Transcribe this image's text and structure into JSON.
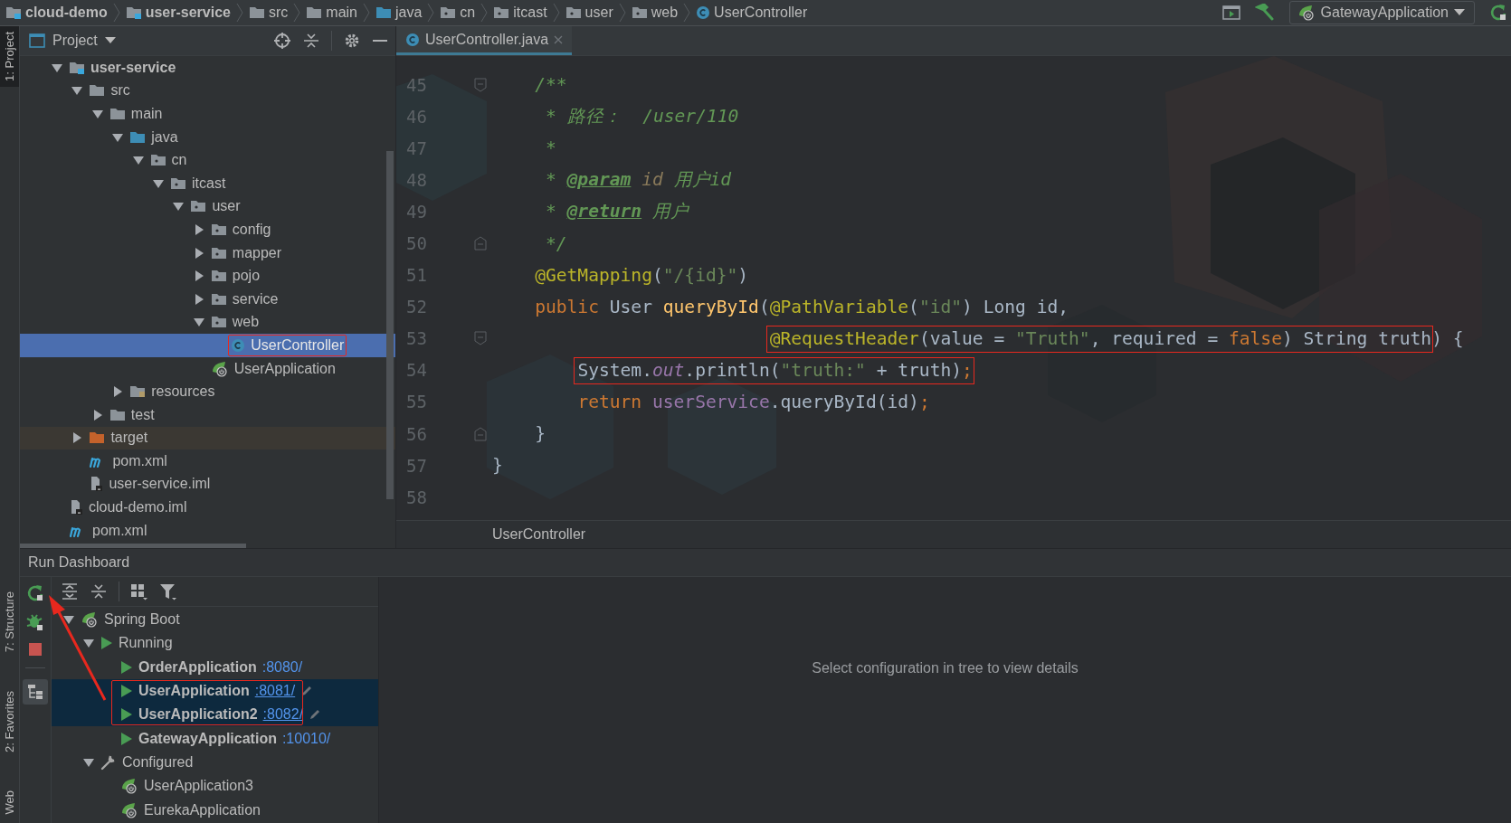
{
  "breadcrumbs": [
    {
      "label": "cloud-demo",
      "kind": "module"
    },
    {
      "label": "user-service",
      "kind": "module"
    },
    {
      "label": "src",
      "kind": "folder"
    },
    {
      "label": "main",
      "kind": "folder"
    },
    {
      "label": "java",
      "kind": "source"
    },
    {
      "label": "cn",
      "kind": "package"
    },
    {
      "label": "itcast",
      "kind": "package"
    },
    {
      "label": "user",
      "kind": "package"
    },
    {
      "label": "web",
      "kind": "package"
    },
    {
      "label": "UserController",
      "kind": "class"
    }
  ],
  "run_config": {
    "label": "GatewayApplication"
  },
  "tool_strip": {
    "top": [
      {
        "label": "1: Project",
        "selected": true
      }
    ],
    "bottom": [
      {
        "label": "7: Structure",
        "selected": false
      },
      {
        "label": "2: Favorites",
        "selected": false
      },
      {
        "label": "Web",
        "selected": false
      }
    ]
  },
  "project_panel": {
    "title": "Project",
    "tree": [
      {
        "label": "user-service",
        "kind": "module",
        "expanded": true,
        "selected": false,
        "boxed": false,
        "children": [
          {
            "label": "src",
            "kind": "folder",
            "expanded": true,
            "selected": false,
            "boxed": false,
            "children": [
              {
                "label": "main",
                "kind": "folder",
                "expanded": true,
                "selected": false,
                "boxed": false,
                "children": [
                  {
                    "label": "java",
                    "kind": "source",
                    "expanded": true,
                    "selected": false,
                    "boxed": false,
                    "children": [
                      {
                        "label": "cn",
                        "kind": "package",
                        "expanded": true,
                        "selected": false,
                        "boxed": false,
                        "children": [
                          {
                            "label": "itcast",
                            "kind": "package",
                            "expanded": true,
                            "selected": false,
                            "boxed": false,
                            "children": [
                              {
                                "label": "user",
                                "kind": "package",
                                "expanded": true,
                                "selected": false,
                                "boxed": false,
                                "children": [
                                  {
                                    "label": "config",
                                    "kind": "package",
                                    "expanded": false,
                                    "selected": false,
                                    "boxed": false
                                  },
                                  {
                                    "label": "mapper",
                                    "kind": "package",
                                    "expanded": false,
                                    "selected": false,
                                    "boxed": false
                                  },
                                  {
                                    "label": "pojo",
                                    "kind": "package",
                                    "expanded": false,
                                    "selected": false,
                                    "boxed": false
                                  },
                                  {
                                    "label": "service",
                                    "kind": "package",
                                    "expanded": false,
                                    "selected": false,
                                    "boxed": false
                                  },
                                  {
                                    "label": "web",
                                    "kind": "package",
                                    "expanded": true,
                                    "selected": false,
                                    "boxed": false,
                                    "children": [
                                      {
                                        "label": "UserController",
                                        "kind": "class",
                                        "selected": true,
                                        "boxed": true
                                      }
                                    ]
                                  },
                                  {
                                    "label": "UserApplication",
                                    "kind": "spring-app",
                                    "selected": false,
                                    "boxed": false
                                  }
                                ]
                              }
                            ]
                          }
                        ]
                      }
                    ]
                  },
                  {
                    "label": "resources",
                    "kind": "resources",
                    "expanded": false,
                    "selected": false,
                    "boxed": false
                  }
                ]
              },
              {
                "label": "test",
                "kind": "folder",
                "expanded": false,
                "selected": false,
                "boxed": false
              }
            ]
          },
          {
            "label": "target",
            "kind": "excluded",
            "expanded": false,
            "selected": false,
            "boxed": false
          },
          {
            "label": "pom.xml",
            "kind": "xml",
            "selected": false,
            "boxed": false
          },
          {
            "label": "user-service.iml",
            "kind": "iml",
            "selected": false,
            "boxed": false
          }
        ]
      },
      {
        "label": "cloud-demo.iml",
        "kind": "iml",
        "selected": false,
        "boxed": false
      },
      {
        "label": "pom.xml",
        "kind": "xml",
        "selected": false,
        "boxed": false
      }
    ]
  },
  "editor": {
    "tab": {
      "label": "UserController.java",
      "selected": true
    },
    "lines": [
      {
        "number": "45",
        "kind": "fold-start",
        "tokens": [
          {
            "text": "    /**",
            "kind": "comment"
          }
        ]
      },
      {
        "number": "46",
        "kind": "plain",
        "tokens": [
          {
            "text": "     * 路径：  /user/110",
            "kind": "comment"
          }
        ]
      },
      {
        "number": "47",
        "kind": "plain",
        "tokens": [
          {
            "text": "     *",
            "kind": "comment"
          }
        ]
      },
      {
        "number": "48",
        "kind": "plain",
        "tokens": [
          {
            "text": "     * ",
            "kind": "comment"
          },
          {
            "text": "@param",
            "kind": "doctag"
          },
          {
            "text": " id",
            "kind": "param"
          },
          {
            "text": " 用户id",
            "kind": "comment"
          }
        ]
      },
      {
        "number": "49",
        "kind": "plain",
        "tokens": [
          {
            "text": "     * ",
            "kind": "comment"
          },
          {
            "text": "@return",
            "kind": "doctag"
          },
          {
            "text": " 用户",
            "kind": "comment"
          }
        ]
      },
      {
        "number": "50",
        "kind": "fold-end",
        "tokens": [
          {
            "text": "     */",
            "kind": "comment"
          }
        ]
      },
      {
        "number": "51",
        "kind": "plain",
        "tokens": [
          {
            "text": "    @GetMapping",
            "kind": "annotation"
          },
          {
            "text": "(",
            "kind": "plain"
          },
          {
            "text": "\"/{id}\"",
            "kind": "string"
          },
          {
            "text": ")",
            "kind": "plain"
          }
        ]
      },
      {
        "number": "52",
        "kind": "plain",
        "tokens": [
          {
            "text": "    public",
            "kind": "keyword"
          },
          {
            "text": " User ",
            "kind": "plain"
          },
          {
            "text": "queryById",
            "kind": "method"
          },
          {
            "text": "(",
            "kind": "plain"
          },
          {
            "text": "@PathVariable",
            "kind": "annotation"
          },
          {
            "text": "(",
            "kind": "plain"
          },
          {
            "text": "\"id\"",
            "kind": "string"
          },
          {
            "text": ") Long id,",
            "kind": "plain"
          }
        ]
      },
      {
        "number": "53",
        "kind": "fold-start",
        "tokens": [
          {
            "text": "                          @RequestHeader",
            "kind": "annotation",
            "boxed": true
          },
          {
            "text": "(value = ",
            "kind": "plain",
            "boxed": true
          },
          {
            "text": "\"Truth\"",
            "kind": "string",
            "boxed": true
          },
          {
            "text": ", required = ",
            "kind": "plain",
            "boxed": true
          },
          {
            "text": "false",
            "kind": "keyword",
            "boxed": true
          },
          {
            "text": ") String truth",
            "kind": "plain",
            "boxed": true
          },
          {
            "text": ") {",
            "kind": "plain",
            "boxed": false
          }
        ]
      },
      {
        "number": "54",
        "kind": "plain",
        "tokens": [
          {
            "text": "        System.",
            "kind": "plain",
            "boxed": true
          },
          {
            "text": "out",
            "kind": "field",
            "boxed": true
          },
          {
            "text": ".println(",
            "kind": "plain",
            "boxed": true
          },
          {
            "text": "\"truth:\"",
            "kind": "string",
            "boxed": true
          },
          {
            "text": " + truth)",
            "kind": "plain",
            "boxed": true
          },
          {
            "text": ";",
            "kind": "keyword",
            "boxed": true
          }
        ]
      },
      {
        "number": "55",
        "kind": "plain",
        "tokens": [
          {
            "text": "        return ",
            "kind": "keyword"
          },
          {
            "text": "userService",
            "kind": "member"
          },
          {
            "text": ".queryById(id)",
            "kind": "plain"
          },
          {
            "text": ";",
            "kind": "keyword"
          }
        ]
      },
      {
        "number": "56",
        "kind": "fold-end",
        "tokens": [
          {
            "text": "    }",
            "kind": "plain"
          }
        ]
      },
      {
        "number": "57",
        "kind": "plain",
        "tokens": [
          {
            "text": "}",
            "kind": "plain"
          }
        ]
      },
      {
        "number": "58",
        "kind": "plain"
      }
    ],
    "breadcrumb": "UserController"
  },
  "run_dashboard": {
    "title": "Run Dashboard",
    "tree": [
      {
        "label": "Spring Boot",
        "kind": "spring-group",
        "expanded": true,
        "selected": false,
        "children": [
          {
            "label": "Running",
            "kind": "running-group",
            "expanded": true,
            "selected": false,
            "children": [
              {
                "label": "OrderApplication",
                "port": ":8080/",
                "kind": "running-app",
                "selected": false,
                "boxed": false
              },
              {
                "label": "UserApplication",
                "port": ":8081/",
                "kind": "running-app",
                "selected": true,
                "boxed": true
              },
              {
                "label": "UserApplication2",
                "port": ":8082/",
                "kind": "running-app",
                "selected": true,
                "boxed": true
              },
              {
                "label": "GatewayApplication",
                "port": ":10010/",
                "kind": "running-app",
                "selected": false,
                "boxed": false
              }
            ]
          },
          {
            "label": "Configured",
            "kind": "configured-group",
            "expanded": true,
            "selected": false,
            "children": [
              {
                "label": "UserApplication3",
                "kind": "spring-app",
                "selected": false
              },
              {
                "label": "EurekaApplication",
                "kind": "spring-app",
                "selected": false
              }
            ]
          }
        ]
      }
    ],
    "empty_message": "Select configuration in tree to view details"
  }
}
